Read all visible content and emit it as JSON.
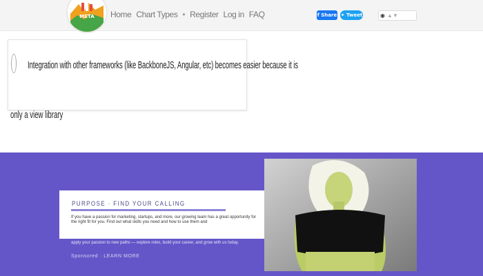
{
  "header": {
    "logo_text": "META",
    "nav": [
      {
        "label": "Home"
      },
      {
        "label": "Chart Types"
      },
      {
        "label": "Register"
      },
      {
        "label": "Log in"
      },
      {
        "label": "FAQ"
      }
    ],
    "nav_separator": "•",
    "facebook_label": "f Share",
    "twitter_label": "Tweet"
  },
  "answer": {
    "text_line1": "Integration with other frameworks (like BackboneJS, Angular, etc) becomes easier because it is",
    "text_line2": "only a view library"
  },
  "promo": {
    "title": "PURPOSE · FIND YOUR CALLING",
    "body": "If you have a passion for marketing, startups, and more, our growing team has a great opportunity for the right fit for you. Find out what skills you need and how to use them and",
    "lower": "apply your passion to new paths — explore roles, build your career, and grow with us today.",
    "stamp": "Sponsored · LEARN MORE",
    "accent_color": "#6456c8"
  }
}
